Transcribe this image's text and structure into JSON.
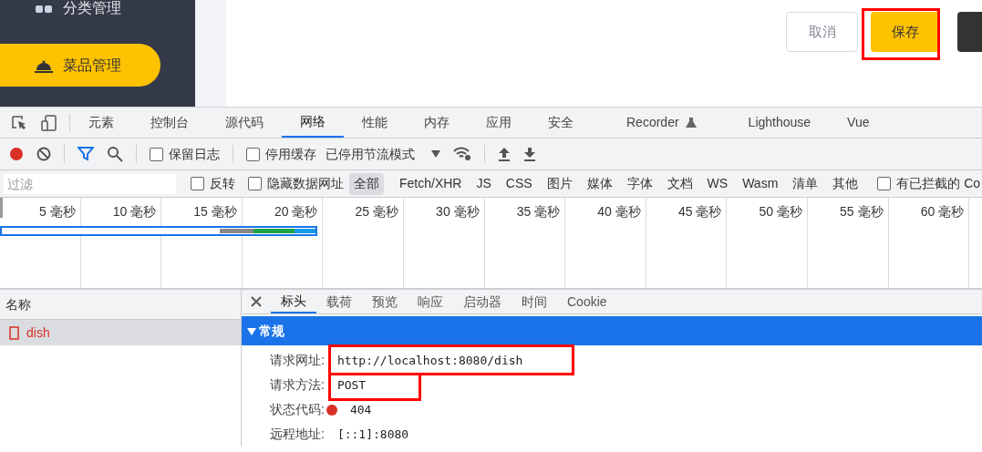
{
  "sidebar": {
    "items": [
      {
        "label": "分类管理",
        "selected": false
      },
      {
        "label": "菜品管理",
        "selected": true
      }
    ]
  },
  "actions": [
    {
      "kind": "secondary",
      "label": "取消"
    },
    {
      "kind": "primary",
      "label": "保存"
    },
    {
      "kind": "dark"
    }
  ],
  "devtools": {
    "tabs": [
      {
        "label": "元素",
        "selected": false
      },
      {
        "label": "控制台",
        "selected": false
      },
      {
        "label": "源代码",
        "selected": false
      },
      {
        "label": "网络",
        "selected": true
      },
      {
        "label": "性能",
        "selected": false
      },
      {
        "label": "内存",
        "selected": false
      },
      {
        "label": "应用",
        "selected": false
      },
      {
        "label": "安全",
        "selected": false
      },
      {
        "label": "Recorder",
        "selected": false,
        "experimental": true
      },
      {
        "label": "Lighthouse",
        "selected": false
      },
      {
        "label": "Vue",
        "selected": false
      }
    ],
    "toolbar": {
      "recording": true,
      "preserve_log": {
        "label": "保留日志",
        "checked": false
      },
      "disable_cache": {
        "label": "停用缓存",
        "checked": false
      },
      "throttling": "已停用节流模式"
    },
    "filter": {
      "placeholder": "过滤",
      "invert": {
        "label": "反转",
        "checked": false
      },
      "hide_data_urls": {
        "label": "隐藏数据网址",
        "checked": false
      },
      "types": [
        {
          "label": "全部",
          "selected": true
        },
        {
          "label": "Fetch/XHR",
          "selected": false
        },
        {
          "label": "JS",
          "selected": false
        },
        {
          "label": "CSS",
          "selected": false
        },
        {
          "label": "图片",
          "selected": false
        },
        {
          "label": "媒体",
          "selected": false
        },
        {
          "label": "字体",
          "selected": false
        },
        {
          "label": "文档",
          "selected": false
        },
        {
          "label": "WS",
          "selected": false
        },
        {
          "label": "Wasm",
          "selected": false
        },
        {
          "label": "清单",
          "selected": false
        },
        {
          "label": "其他",
          "selected": false
        }
      ],
      "blocked_cookies": {
        "label": "有已拦截的 Co",
        "checked": false
      }
    },
    "timeline": {
      "ticks": [
        "5 毫秒",
        "10 毫秒",
        "15 毫秒",
        "20 毫秒",
        "25 毫秒",
        "30 毫秒",
        "35 毫秒",
        "40 毫秒",
        "45 毫秒",
        "50 毫秒",
        "55 毫秒",
        "60 毫秒"
      ]
    },
    "requests": {
      "column": "名称",
      "rows": [
        {
          "name": "dish",
          "selected": true,
          "failed": true
        }
      ]
    },
    "detail": {
      "tabs": [
        {
          "label": "标头",
          "selected": true
        },
        {
          "label": "载荷",
          "selected": false
        },
        {
          "label": "预览",
          "selected": false
        },
        {
          "label": "响应",
          "selected": false
        },
        {
          "label": "启动器",
          "selected": false
        },
        {
          "label": "时间",
          "selected": false
        },
        {
          "label": "Cookie",
          "selected": false
        }
      ],
      "section": {
        "title": "常规",
        "expanded": true
      },
      "fields": [
        {
          "label": "请求网址:",
          "value": "http://localhost:8080/dish"
        },
        {
          "label": "请求方法:",
          "value": "POST"
        },
        {
          "label": "状态代码:",
          "value": "404",
          "kind": "status"
        },
        {
          "label": "远程地址:",
          "value": "[::1]:8080"
        }
      ]
    }
  }
}
